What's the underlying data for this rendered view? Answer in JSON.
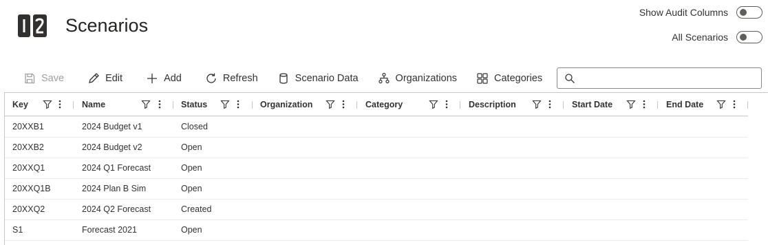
{
  "page": {
    "title": "Scenarios"
  },
  "toggles": [
    {
      "label": "Show Audit Columns",
      "on": false
    },
    {
      "label": "All Scenarios",
      "on": false
    }
  ],
  "toolbar": {
    "save": "Save",
    "edit": "Edit",
    "add": "Add",
    "refresh": "Refresh",
    "scenario_data": "Scenario Data",
    "organizations": "Organizations",
    "categories": "Categories"
  },
  "search": {
    "value": "",
    "placeholder": ""
  },
  "columns": [
    "Key",
    "Name",
    "Status",
    "Organization",
    "Category",
    "Description",
    "Start Date",
    "End Date"
  ],
  "rows": [
    {
      "key": "20XXB1",
      "name": "2024 Budget v1",
      "status": "Closed"
    },
    {
      "key": "20XXB2",
      "name": "2024 Budget v2",
      "status": "Open"
    },
    {
      "key": "20XXQ1",
      "name": "2024 Q1 Forecast",
      "status": "Open"
    },
    {
      "key": "20XXQ1B",
      "name": "2024 Plan B Sim",
      "status": "Open"
    },
    {
      "key": "20XXQ2",
      "name": "2024 Q2 Forecast",
      "status": "Created"
    },
    {
      "key": "S1",
      "name": "Forecast 2021",
      "status": "Open"
    }
  ]
}
